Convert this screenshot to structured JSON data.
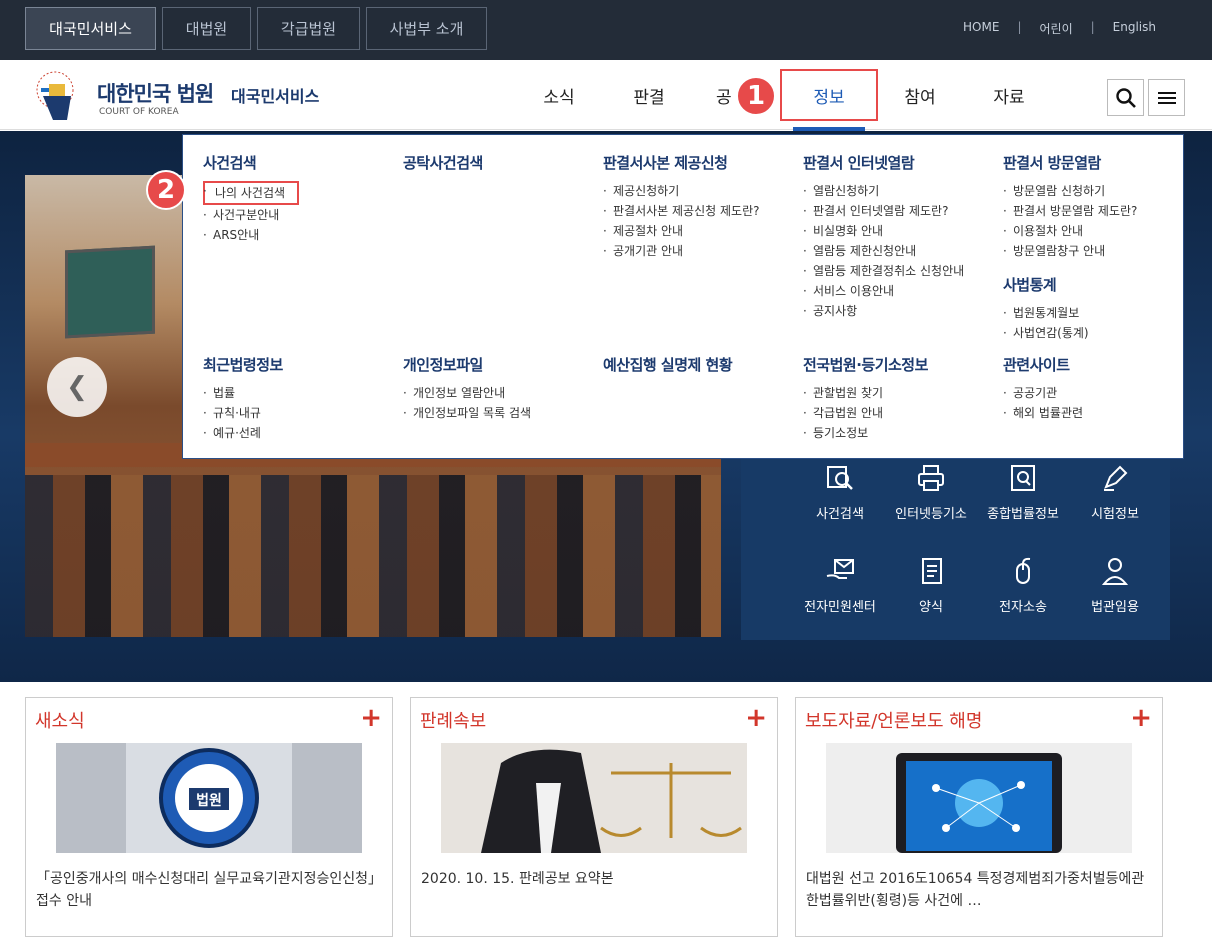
{
  "topbar": {
    "tabs": [
      {
        "label": "대국민서비스"
      },
      {
        "label": "대법원"
      },
      {
        "label": "각급법원"
      },
      {
        "label": "사법부 소개"
      }
    ],
    "links": [
      {
        "label": "HOME"
      },
      {
        "label": "어린이"
      },
      {
        "label": "English"
      }
    ]
  },
  "header": {
    "logo_title": "대한민국 법원",
    "logo_sub": "COURT OF KOREA",
    "service_title": "대국민서비스",
    "nav": [
      {
        "label": "소식"
      },
      {
        "label": "판결"
      },
      {
        "label": "공"
      },
      {
        "label": "정보"
      },
      {
        "label": "참여"
      },
      {
        "label": "자료"
      }
    ]
  },
  "badges": {
    "one": "1",
    "two": "2"
  },
  "mega_menu": {
    "case_search": {
      "title": "사건검색",
      "items": [
        "나의 사건검색",
        "사건구분안내",
        "ARS안내"
      ]
    },
    "deposit_search": {
      "title": "공탁사건검색",
      "items": []
    },
    "copy_request": {
      "title": "판결서사본 제공신청",
      "items": [
        "제공신청하기",
        "판결서사본 제공신청 제도란?",
        "제공절차 안내",
        "공개기관 안내"
      ]
    },
    "online_view": {
      "title": "판결서 인터넷열람",
      "items": [
        "열람신청하기",
        "판결서 인터넷열람 제도란?",
        "비실명화 안내",
        "열람등 제한신청안내",
        "열람등 제한결정취소 신청안내",
        "서비스 이용안내",
        "공지사항"
      ]
    },
    "visit_view": {
      "title": "판결서 방문열람",
      "items": [
        "방문열람 신청하기",
        "판결서 방문열람 제도란?",
        "이용절차 안내",
        "방문열람창구 안내"
      ]
    },
    "stats": {
      "title": "사법통계",
      "items": [
        "법원통계월보",
        "사법연감(통계)"
      ]
    },
    "law_info": {
      "title": "최근법령정보",
      "items": [
        "법률",
        "규칙·내규",
        "예규·선례"
      ]
    },
    "privacy": {
      "title": "개인정보파일",
      "items": [
        "개인정보 열람안내",
        "개인정보파일 목록 검색"
      ]
    },
    "budget": {
      "title": "예산집행 실명제 현황",
      "items": []
    },
    "courts": {
      "title": "전국법원·등기소정보",
      "items": [
        "관할법원 찾기",
        "각급법원 안내",
        "등기소정보"
      ]
    },
    "related": {
      "title": "관련사이트",
      "items": [
        "공공기관",
        "해외 법률관련"
      ]
    }
  },
  "quick_menu": [
    {
      "label": "사건검색",
      "icon": "search-doc-icon"
    },
    {
      "label": "인터넷등기소",
      "icon": "printer-icon"
    },
    {
      "label": "종합법률정보",
      "icon": "law-book-icon"
    },
    {
      "label": "시험정보",
      "icon": "pen-icon"
    },
    {
      "label": "전자민원센터",
      "icon": "mail-hand-icon"
    },
    {
      "label": "양식",
      "icon": "form-icon"
    },
    {
      "label": "전자소송",
      "icon": "mouse-icon"
    },
    {
      "label": "법관임용",
      "icon": "judge-icon"
    }
  ],
  "cards": [
    {
      "title": "새소식",
      "plus": "+",
      "text": "「공인중개사의 매수신청대리 실무교육기관지정승인신청」접수 안내",
      "thumb_label": "법원"
    },
    {
      "title": "판례속보",
      "plus": "+",
      "text": "2020. 10. 15. 판례공보 요약본"
    },
    {
      "title": "보도자료/언론보도 해명",
      "plus": "+",
      "text": "대법원 선고 2016도10654 특정경제범죄가중처벌등에관한법률위반(횡령)등 사건에 …"
    }
  ],
  "colors": {
    "navy": "#1c3a6e",
    "accent_red": "#e74a4a",
    "active_blue": "#1e5bb5",
    "topbar": "#232c38"
  }
}
